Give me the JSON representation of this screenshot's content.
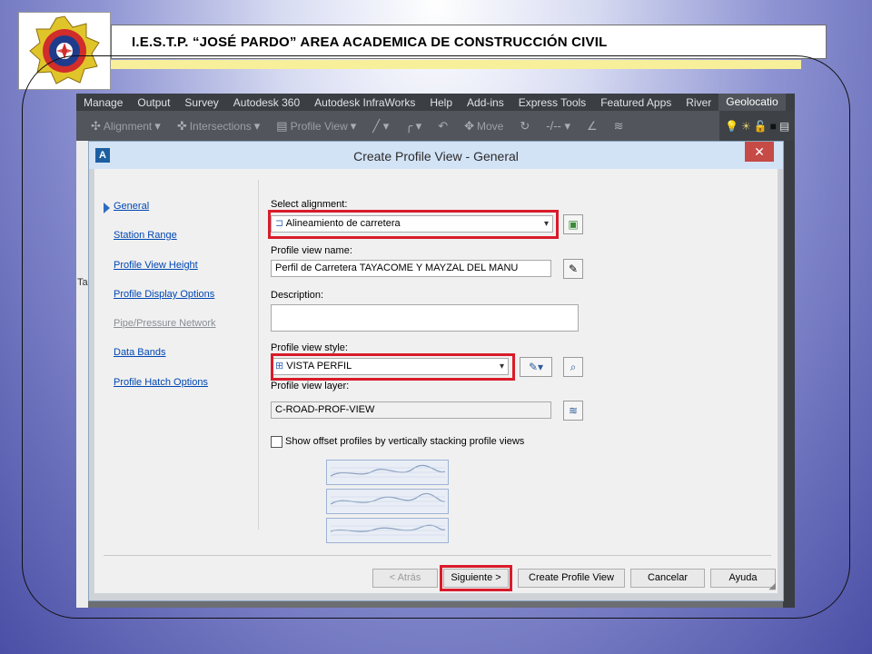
{
  "slide": {
    "title": "I.E.S.T.P. “JOSÉ PARDO” AREA ACADEMICA DE CONSTRUCCIÓN CIVIL"
  },
  "ribbon": {
    "tabs": [
      "Manage",
      "Output",
      "Survey",
      "Autodesk 360",
      "Autodesk InfraWorks",
      "Help",
      "Add-ins",
      "Express Tools",
      "Featured Apps",
      "River",
      "Geolocatio"
    ],
    "active_tab_index": 10,
    "tools": [
      "Alignment",
      "Intersections",
      "Profile View",
      "Move"
    ]
  },
  "workspace": {
    "left_fragment": "Ta"
  },
  "dialog": {
    "app_icon": "A",
    "title": "Create Profile View - General",
    "close_symbol": "✕",
    "nav": [
      "General",
      "Station Range",
      "Profile View Height",
      "Profile Display Options",
      "Pipe/Pressure Network",
      "Data Bands",
      "Profile Hatch Options"
    ],
    "nav_disabled_index": 4,
    "fields": {
      "select_alignment_label": "Select alignment:",
      "select_alignment_value": "Alineamiento de carretera",
      "profile_view_name_label": "Profile view name:",
      "profile_view_name_value": "Perfil de Carretera TAYACOME Y MAYZAL DEL MANU",
      "description_label": "Description:",
      "description_value": "",
      "style_label": "Profile view style:",
      "style_value": "VISTA PERFIL",
      "layer_label": "Profile view layer:",
      "layer_value": "C-ROAD-PROF-VIEW",
      "stack_checkbox_label": "Show offset profiles by vertically stacking profile views",
      "stack_checked": false
    },
    "buttons": {
      "back": "< Atrás",
      "next": "Siguiente >",
      "create": "Create Profile View",
      "cancel": "Cancelar",
      "help": "Ayuda"
    }
  },
  "colors": {
    "highlight": "#d91b2a",
    "link": "#0047b3",
    "title_bar": "#d3e3f6",
    "close_button": "#c64a46"
  }
}
